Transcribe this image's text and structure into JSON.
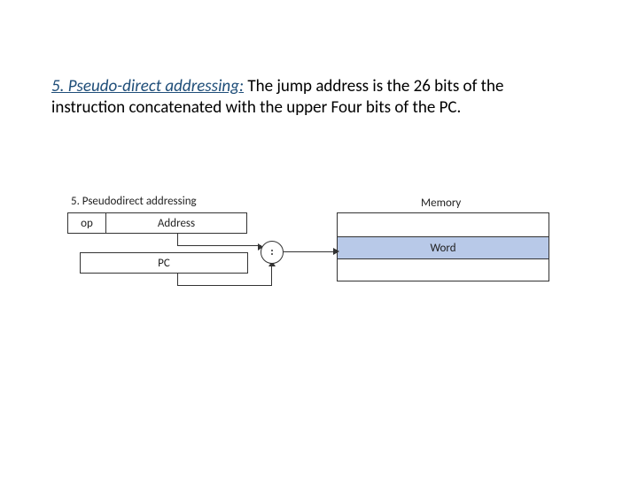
{
  "text": {
    "heading": "5. Pseudo-direct addressing:",
    "body": " The jump address is the 26 bits of the instruction concatenated with the upper Four bits of the PC."
  },
  "diagram": {
    "title": "5.  Pseudodirect addressing",
    "op": "op",
    "address": "Address",
    "pc": "PC",
    "memory_label": "Memory",
    "word": "Word"
  }
}
